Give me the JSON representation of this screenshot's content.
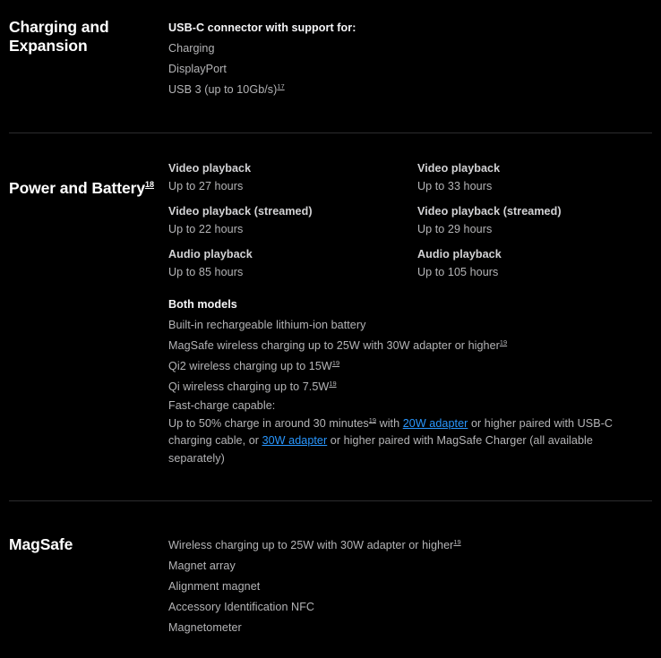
{
  "page": {
    "background": "#000000",
    "text_color": "#b4b4b6",
    "heading_color": "#ffffff",
    "link_color": "#2997ff",
    "divider_color": "#2c2c2e"
  },
  "sections": [
    {
      "id": "charging-and-expansion",
      "heading": "Charging and\nExpansion",
      "lead": "USB-C connector with support for:",
      "items": [
        "Charging",
        "DisplayPort",
        "USB 3 (up to 10Gb/s)"
      ],
      "usb3_footnote": "17"
    },
    {
      "id": "power-and-battery",
      "heading": "Power and Battery",
      "heading_footnote": "18",
      "column_left": [
        {
          "label": "Video playback",
          "value": "Up to 27 hours"
        },
        {
          "label": "Video playback (streamed)",
          "value": "Up to 22 hours"
        },
        {
          "label": "Audio playback",
          "value": "Up to 85 hours"
        }
      ],
      "column_right": [
        {
          "label": "Video playback",
          "value": "Up to 33 hours"
        },
        {
          "label": "Video playback (streamed)",
          "value": "Up to 29 hours"
        },
        {
          "label": "Audio playback",
          "value": "Up to 105 hours"
        }
      ],
      "both_models_title": "Both models",
      "both_models_lines": [
        {
          "text": "Built-in rechargeable lithium-ion battery",
          "footnote": ""
        },
        {
          "text": "MagSafe wireless charging up to 25W with 30W adapter or higher",
          "footnote": "19"
        },
        {
          "text": "Qi2 wireless charging up to 15W",
          "footnote": "19"
        },
        {
          "text": "Qi wireless charging up to 7.5W",
          "footnote": "19"
        }
      ],
      "fast_charge": {
        "title": "Fast-charge capable:",
        "part_1": "Up to 50% charge in around 30 minutes",
        "footnote": "19",
        "part_2": " with ",
        "link_1": "20W adapter",
        "part_3": " or higher paired with USB-C charging cable, or ",
        "link_2": "30W adapter",
        "part_4": " or higher paired with MagSafe Charger (all available separately)"
      }
    },
    {
      "id": "magsafe",
      "heading": "MagSafe",
      "items": [
        {
          "text": "Wireless charging up to 25W with 30W adapter or higher",
          "footnote": "19"
        },
        {
          "text": "Magnet array",
          "footnote": ""
        },
        {
          "text": "Alignment magnet",
          "footnote": ""
        },
        {
          "text": "Accessory Identification NFC",
          "footnote": ""
        },
        {
          "text": "Magnetometer",
          "footnote": ""
        }
      ]
    }
  ]
}
